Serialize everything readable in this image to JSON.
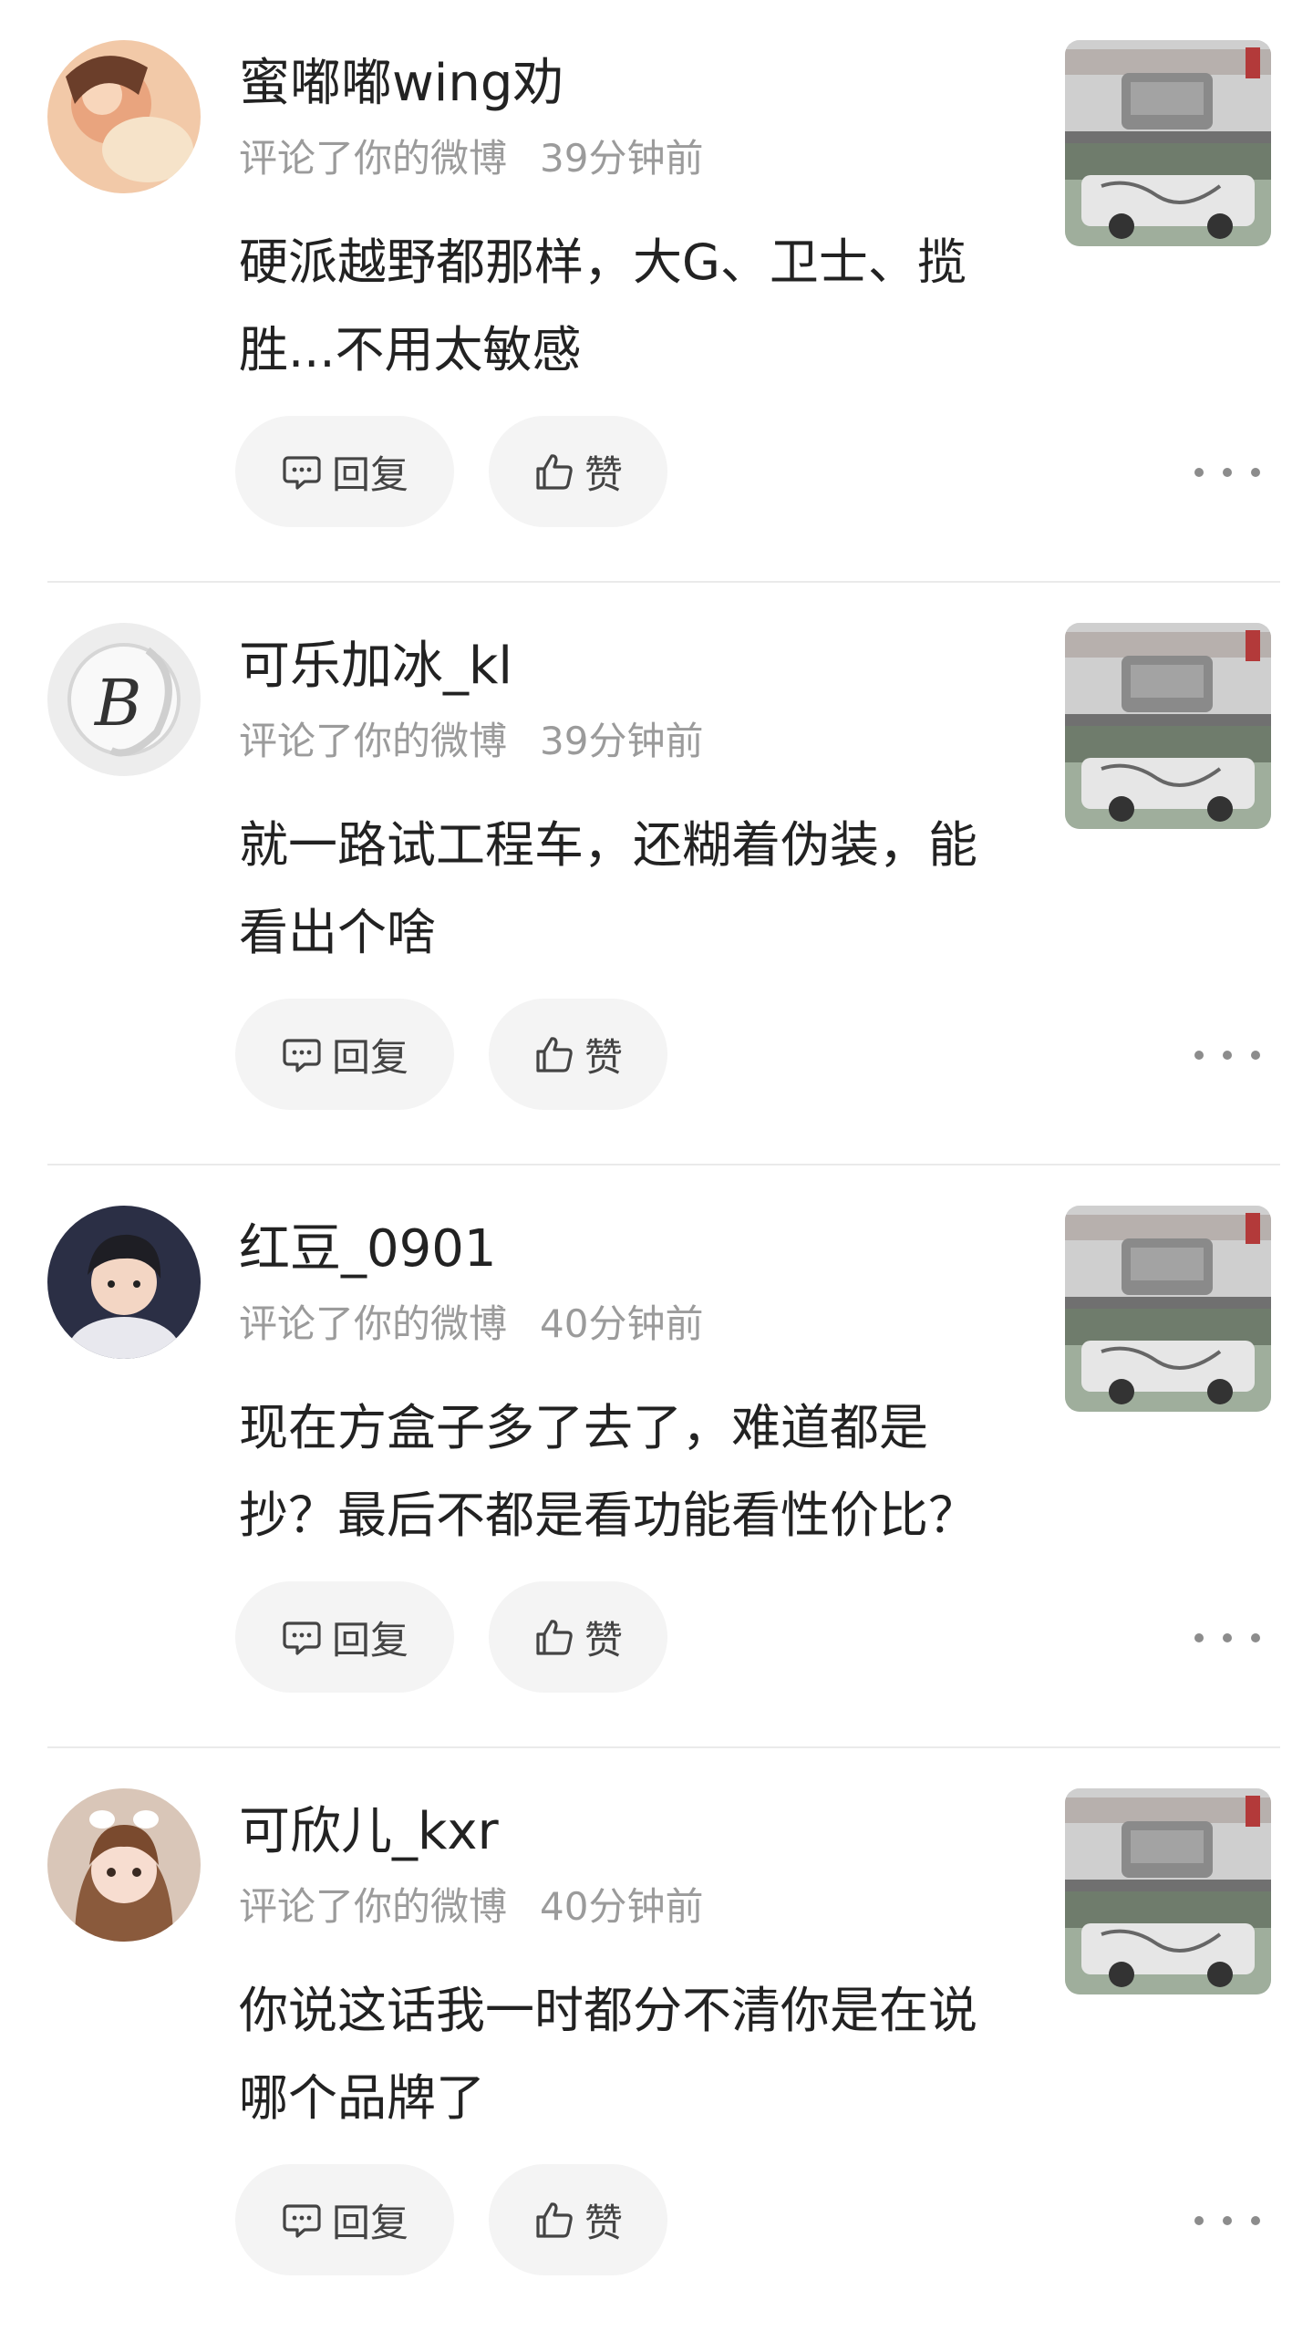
{
  "comments": [
    {
      "username": "蜜嘟嘟wing劝",
      "meta_action": "评论了你的微博",
      "time": "39分钟前",
      "content": "硬派越野都那样，大G、卫士、揽胜...不用太敏感",
      "reply_label": "回复",
      "like_label": "赞"
    },
    {
      "username": "可乐加冰_kl",
      "meta_action": "评论了你的微博",
      "time": "39分钟前",
      "content": "就一路试工程车，还糊着伪装，能看出个啥",
      "reply_label": "回复",
      "like_label": "赞"
    },
    {
      "username": "红豆_0901",
      "meta_action": "评论了你的微博",
      "time": "40分钟前",
      "content": "现在方盒子多了去了，难道都是抄？最后不都是看功能看性价比？",
      "reply_label": "回复",
      "like_label": "赞"
    },
    {
      "username": "可欣儿_kxr",
      "meta_action": "评论了你的微博",
      "time": "40分钟前",
      "content": "你说这话我一时都分不清你是在说哪个品牌了",
      "reply_label": "回复",
      "like_label": "赞"
    }
  ],
  "colors": {
    "background": "#ffffff",
    "text_primary": "#222222",
    "text_secondary": "#9b9b9b",
    "button_background": "#f4f4f4",
    "divider": "#eaeaea"
  },
  "icons": {
    "reply": "comment-bubble-icon",
    "like": "thumbs-up-icon",
    "more": "more-dots-icon"
  }
}
